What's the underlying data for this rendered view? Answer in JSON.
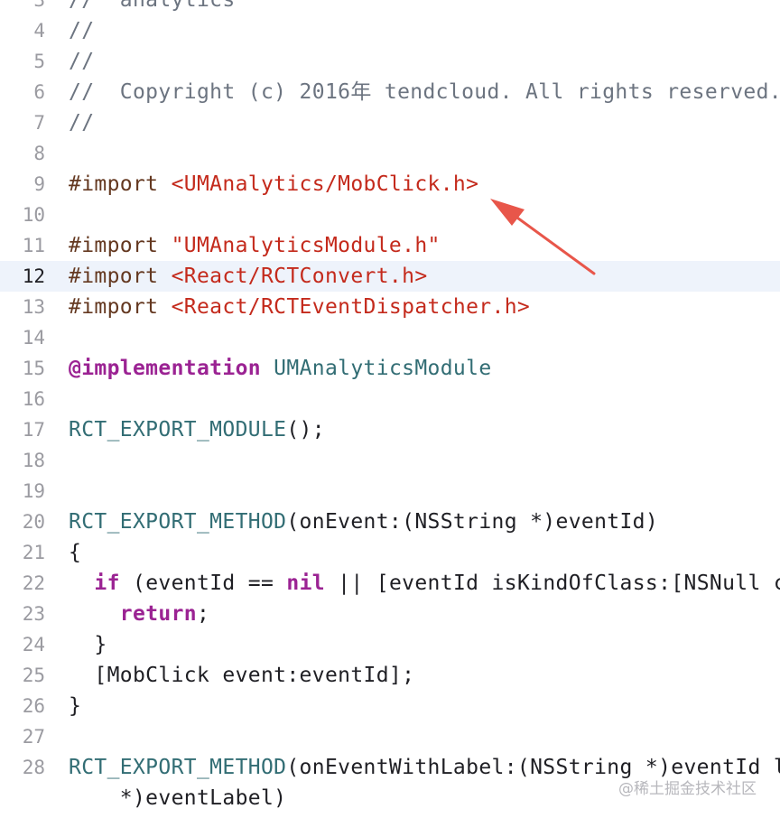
{
  "editor": {
    "lines": [
      {
        "num": "3",
        "tokens": [
          {
            "t": "//  analytics",
            "c": "comment"
          }
        ]
      },
      {
        "num": "4",
        "tokens": [
          {
            "t": "//",
            "c": "comment"
          }
        ]
      },
      {
        "num": "5",
        "tokens": [
          {
            "t": "//",
            "c": "comment"
          }
        ]
      },
      {
        "num": "6",
        "tokens": [
          {
            "t": "//  Copyright (c) 2016年 tendcloud. All rights reserved.",
            "c": "comment"
          }
        ]
      },
      {
        "num": "7",
        "tokens": [
          {
            "t": "//",
            "c": "comment"
          }
        ]
      },
      {
        "num": "8",
        "tokens": []
      },
      {
        "num": "9",
        "tokens": [
          {
            "t": "#import ",
            "c": "pre"
          },
          {
            "t": "<UMAnalytics/MobClick.h>",
            "c": "str"
          }
        ]
      },
      {
        "num": "10",
        "tokens": []
      },
      {
        "num": "11",
        "tokens": [
          {
            "t": "#import ",
            "c": "pre"
          },
          {
            "t": "\"UMAnalyticsModule.h\"",
            "c": "str"
          }
        ]
      },
      {
        "num": "12",
        "current": true,
        "tokens": [
          {
            "t": "#import ",
            "c": "pre"
          },
          {
            "t": "<React/RCTConvert.h>",
            "c": "str"
          }
        ]
      },
      {
        "num": "13",
        "tokens": [
          {
            "t": "#import ",
            "c": "pre"
          },
          {
            "t": "<React/RCTEventDispatcher.h>",
            "c": "str"
          }
        ]
      },
      {
        "num": "14",
        "tokens": []
      },
      {
        "num": "15",
        "tokens": [
          {
            "t": "@implementation",
            "c": "kw"
          },
          {
            "t": " ",
            "c": "plain"
          },
          {
            "t": "UMAnalyticsModule",
            "c": "cls"
          }
        ]
      },
      {
        "num": "16",
        "tokens": []
      },
      {
        "num": "17",
        "tokens": [
          {
            "t": "RCT_EXPORT_MODULE",
            "c": "cls"
          },
          {
            "t": "();",
            "c": "plain"
          }
        ]
      },
      {
        "num": "18",
        "tokens": []
      },
      {
        "num": "19",
        "tokens": []
      },
      {
        "num": "20",
        "tokens": [
          {
            "t": "RCT_EXPORT_METHOD",
            "c": "cls"
          },
          {
            "t": "(onEvent:(NSString *)eventId)",
            "c": "plain"
          }
        ]
      },
      {
        "num": "21",
        "tokens": [
          {
            "t": "{",
            "c": "plain"
          }
        ]
      },
      {
        "num": "22",
        "tokens": [
          {
            "t": "  ",
            "c": "plain"
          },
          {
            "t": "if",
            "c": "kw"
          },
          {
            "t": " (eventId == ",
            "c": "plain"
          },
          {
            "t": "nil",
            "c": "kw"
          },
          {
            "t": " || [eventId isKindOfClass:[NSNull class]]) {",
            "c": "plain"
          }
        ]
      },
      {
        "num": "23",
        "tokens": [
          {
            "t": "    ",
            "c": "plain"
          },
          {
            "t": "return",
            "c": "kw"
          },
          {
            "t": ";",
            "c": "plain"
          }
        ]
      },
      {
        "num": "24",
        "tokens": [
          {
            "t": "  }",
            "c": "plain"
          }
        ]
      },
      {
        "num": "25",
        "tokens": [
          {
            "t": "  [MobClick event:eventId];",
            "c": "plain"
          }
        ]
      },
      {
        "num": "26",
        "tokens": [
          {
            "t": "}",
            "c": "plain"
          }
        ]
      },
      {
        "num": "27",
        "tokens": []
      },
      {
        "num": "28",
        "tokens": [
          {
            "t": "RCT_EXPORT_METHOD",
            "c": "cls"
          },
          {
            "t": "(onEventWithLabel:(NSString *)eventId label:(NSString",
            "c": "plain"
          }
        ]
      },
      {
        "num": "",
        "tokens": [
          {
            "t": "    *)eventLabel)",
            "c": "plain"
          }
        ]
      }
    ]
  },
  "annotation": {
    "arrow_color": "#e8564a",
    "arrow_icon": "arrow-icon"
  },
  "watermark": {
    "text": "@稀土掘金技术社区"
  }
}
